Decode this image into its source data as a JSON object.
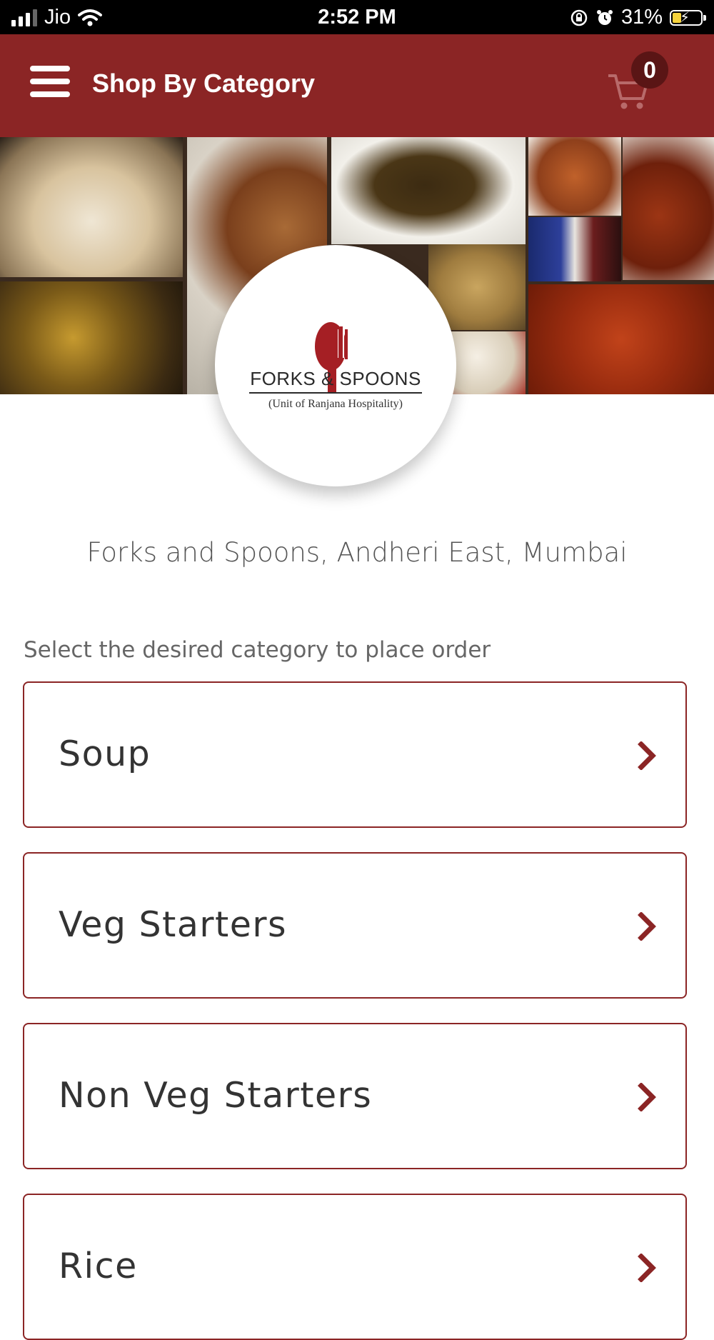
{
  "status_bar": {
    "carrier": "Jio",
    "time": "2:52 PM",
    "battery": "31%",
    "icons": [
      "signal-icon",
      "wifi-icon",
      "orientation-lock-icon",
      "alarm-icon",
      "battery-charging-icon"
    ]
  },
  "header": {
    "title": "Shop By Category",
    "cart_count": "0",
    "icons": [
      "menu-icon",
      "cart-icon"
    ]
  },
  "logo": {
    "name": "FORKS & SPOONS",
    "subtitle": "(Unit of Ranjana Hospitality)"
  },
  "store": {
    "name": "Forks and Spoons, Andheri East, Mumbai"
  },
  "instruction": "Select the desired category to place order",
  "categories": [
    {
      "label": "Soup"
    },
    {
      "label": "Veg Starters"
    },
    {
      "label": "Non Veg Starters"
    },
    {
      "label": "Rice"
    }
  ],
  "colors": {
    "brand": "#8b2525",
    "badge": "#5a1515",
    "text": "#333333"
  }
}
